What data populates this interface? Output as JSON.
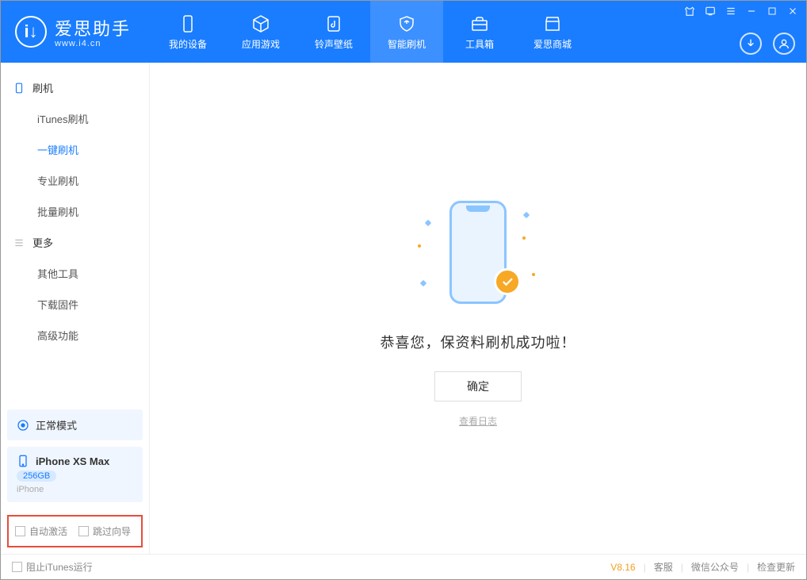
{
  "app": {
    "name": "爱思助手",
    "site": "www.i4.cn"
  },
  "nav": {
    "tabs": [
      {
        "label": "我的设备",
        "icon": "phone"
      },
      {
        "label": "应用游戏",
        "icon": "cube"
      },
      {
        "label": "铃声壁纸",
        "icon": "music"
      },
      {
        "label": "智能刷机",
        "icon": "shield",
        "active": true
      },
      {
        "label": "工具箱",
        "icon": "toolbox"
      },
      {
        "label": "爱思商城",
        "icon": "store"
      }
    ]
  },
  "sidebar": {
    "groups": [
      {
        "title": "刷机",
        "items": [
          {
            "label": "iTunes刷机"
          },
          {
            "label": "一键刷机",
            "active": true
          },
          {
            "label": "专业刷机"
          },
          {
            "label": "批量刷机"
          }
        ]
      },
      {
        "title": "更多",
        "items": [
          {
            "label": "其他工具"
          },
          {
            "label": "下载固件"
          },
          {
            "label": "高级功能"
          }
        ]
      }
    ],
    "mode_label": "正常模式",
    "device": {
      "name": "iPhone XS Max",
      "capacity": "256GB",
      "type": "iPhone"
    },
    "checks": {
      "auto_activate": "自动激活",
      "skip_guide": "跳过向导"
    }
  },
  "main": {
    "success_msg": "恭喜您，保资料刷机成功啦！",
    "confirm_btn": "确定",
    "log_link": "查看日志"
  },
  "footer": {
    "block_itunes": "阻止iTunes运行",
    "version": "V8.16",
    "links": {
      "service": "客服",
      "wechat": "微信公众号",
      "update": "检查更新"
    }
  }
}
